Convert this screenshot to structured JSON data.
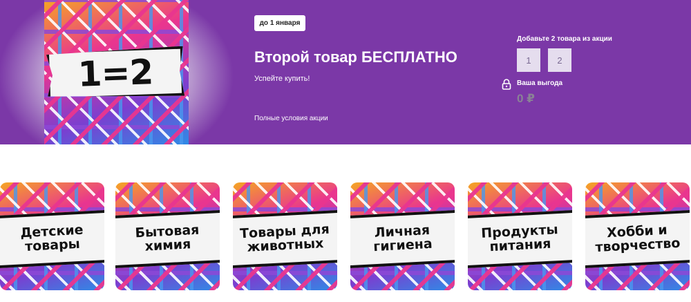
{
  "promo": {
    "image_text": "1=2",
    "date_badge": "до 1 января",
    "title": "Второй товар БЕСПЛАТНО",
    "subtitle": "Успейте купить!",
    "terms_link": "Полные условия акции"
  },
  "selector": {
    "label": "Добавьте 2 товара из акции",
    "slots": [
      "1",
      "2"
    ],
    "benefit_label": "Ваша выгода",
    "benefit_value": "0 ₽",
    "lock_icon": "lock-icon"
  },
  "categories": [
    {
      "label": "Детские\nтовары"
    },
    {
      "label": "Бытовая\nхимия"
    },
    {
      "label": "Товары для\nживотных"
    },
    {
      "label": "Личная\nгигиена"
    },
    {
      "label": "Продукты\nпитания"
    },
    {
      "label": "Хобби и\nтворчество"
    }
  ],
  "colors": {
    "banner_bg": "#7b38a7",
    "slot_bg": "#e5ddee",
    "pattern_pink": "#e9358f",
    "pattern_blue": "#2f8be6",
    "pattern_orange": "#f5a623"
  }
}
